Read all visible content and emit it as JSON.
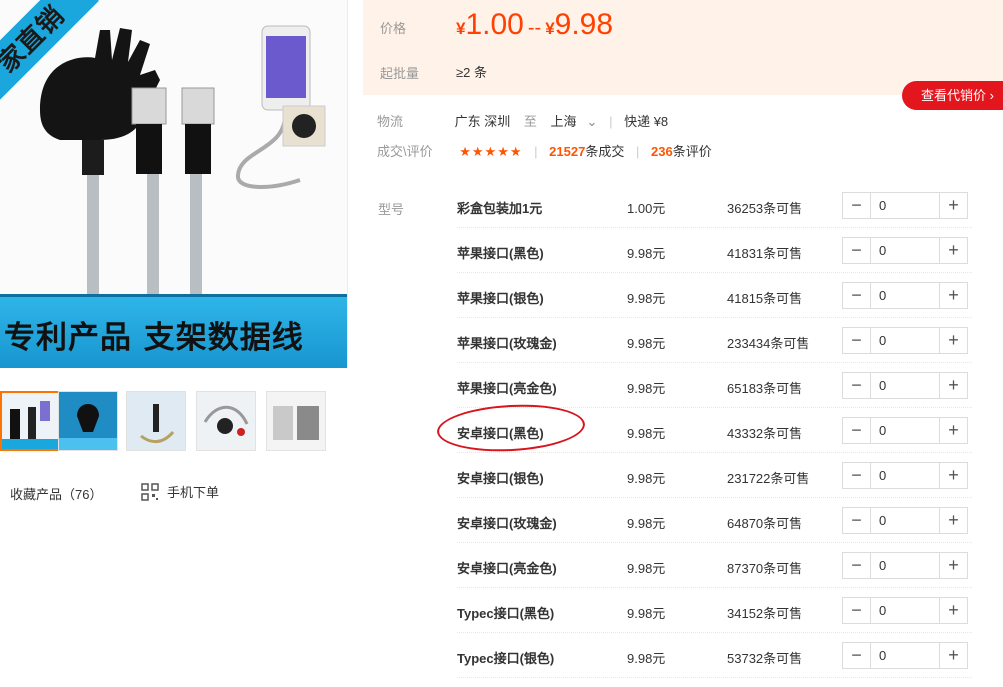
{
  "gallery": {
    "ribbon_text": "家直销",
    "banner_text": "专利产品 支架数据线",
    "thumbnails": [
      "thumb-1",
      "thumb-2",
      "thumb-3",
      "thumb-4",
      "thumb-5"
    ]
  },
  "actions": {
    "favorite_label": "收藏产品（76）",
    "mobile_order_label": "手机下单"
  },
  "price": {
    "label": "价格",
    "currency": "¥",
    "min": "1.00",
    "separator": "--",
    "max": "9.98",
    "moq_label": "起批量",
    "moq_value": "≥2 条"
  },
  "agent_button": {
    "label": "查看代销价 ›"
  },
  "logistics": {
    "label": "物流",
    "from": "广东 深圳",
    "to_word": "至",
    "to": "上海",
    "shipping": "快递 ¥8"
  },
  "reviews": {
    "label": "成交\\评价",
    "stars": "★★★★★",
    "sold_count": "21527",
    "sold_unit": "条成交",
    "review_count": "236",
    "review_unit": "条评价"
  },
  "sku": {
    "label": "型号",
    "rows": [
      {
        "name": "彩盒包装加1元",
        "price": "1.00元",
        "stock": "36253条可售",
        "qty": "0"
      },
      {
        "name": "苹果接口(黑色)",
        "price": "9.98元",
        "stock": "41831条可售",
        "qty": "0"
      },
      {
        "name": "苹果接口(银色)",
        "price": "9.98元",
        "stock": "41815条可售",
        "qty": "0"
      },
      {
        "name": "苹果接口(玫瑰金)",
        "price": "9.98元",
        "stock": "233434条可售",
        "qty": "0"
      },
      {
        "name": "苹果接口(亮金色)",
        "price": "9.98元",
        "stock": "65183条可售",
        "qty": "0"
      },
      {
        "name": "安卓接口(黑色)",
        "price": "9.98元",
        "stock": "43332条可售",
        "qty": "0"
      },
      {
        "name": "安卓接口(银色)",
        "price": "9.98元",
        "stock": "231722条可售",
        "qty": "0"
      },
      {
        "name": "安卓接口(玫瑰金)",
        "price": "9.98元",
        "stock": "64870条可售",
        "qty": "0"
      },
      {
        "name": "安卓接口(亮金色)",
        "price": "9.98元",
        "stock": "87370条可售",
        "qty": "0"
      },
      {
        "name": "Typec接口(黑色)",
        "price": "9.98元",
        "stock": "34152条可售",
        "qty": "0"
      },
      {
        "name": "Typec接口(银色)",
        "price": "9.98元",
        "stock": "53732条可售",
        "qty": "0"
      }
    ]
  },
  "colors": {
    "accent": "#ff4000",
    "price_bg": "#fff2e8",
    "agent_button": "#e4161d",
    "annotation": "#d9141c"
  }
}
